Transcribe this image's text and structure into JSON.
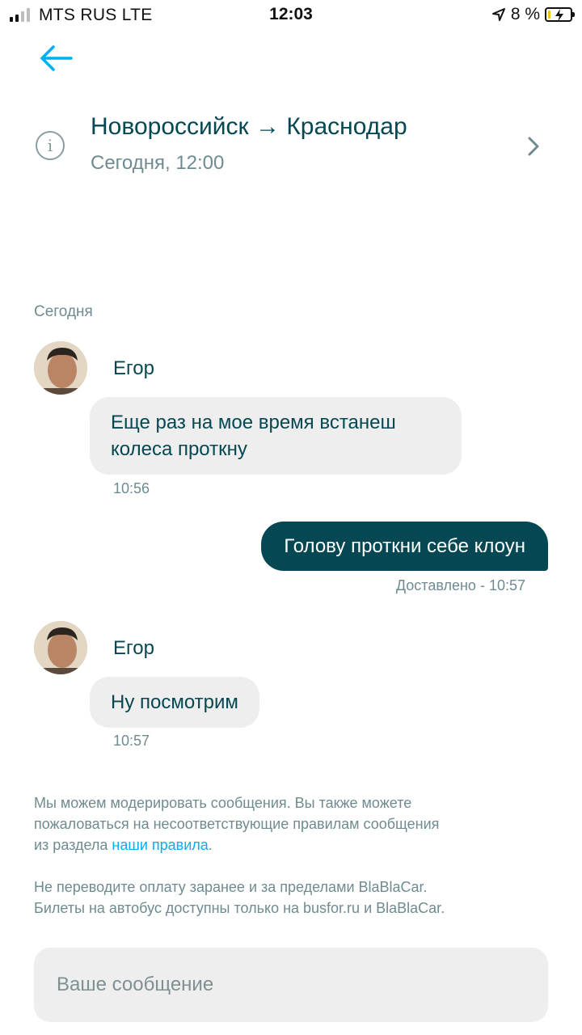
{
  "status_bar": {
    "carrier": "MTS RUS  LTE",
    "time": "12:03",
    "battery_percent": "8 %"
  },
  "header": {
    "route": "Новороссийск → Краснодар",
    "date": "Сегодня, 12:00"
  },
  "chat": {
    "day_label": "Сегодня",
    "messages": [
      {
        "sender": "Егор",
        "lines": [
          "Еще раз на мое время встанеш",
          "колеса проткну"
        ],
        "time": "10:56"
      },
      {
        "text": "Голову проткни себе клоун",
        "status": "Доставлено - 10:57"
      },
      {
        "sender": "Егор",
        "text": "Ну посмотрим",
        "time": "10:57"
      }
    ]
  },
  "notice": {
    "moderation_line1": "Мы можем модерировать сообщения. Вы также можете",
    "moderation_line2": "пожаловаться на несоответствующие правилам сообщения",
    "moderation_line3_prefix": "из раздела ",
    "rules_link": "наши правила",
    "moderation_line3_suffix": ".",
    "payment_line1": "Не переводите оплату заранее и за пределами BlaBlaCar.",
    "payment_line2": "Билеты на автобус доступны только на busfor.ru и BlaBlaCar."
  },
  "composer": {
    "placeholder": "Ваше сообщение"
  },
  "colors": {
    "primary": "#054752",
    "secondary_text": "#6f8b90",
    "link": "#00aff5",
    "bubble_incoming": "#eeeeee"
  }
}
